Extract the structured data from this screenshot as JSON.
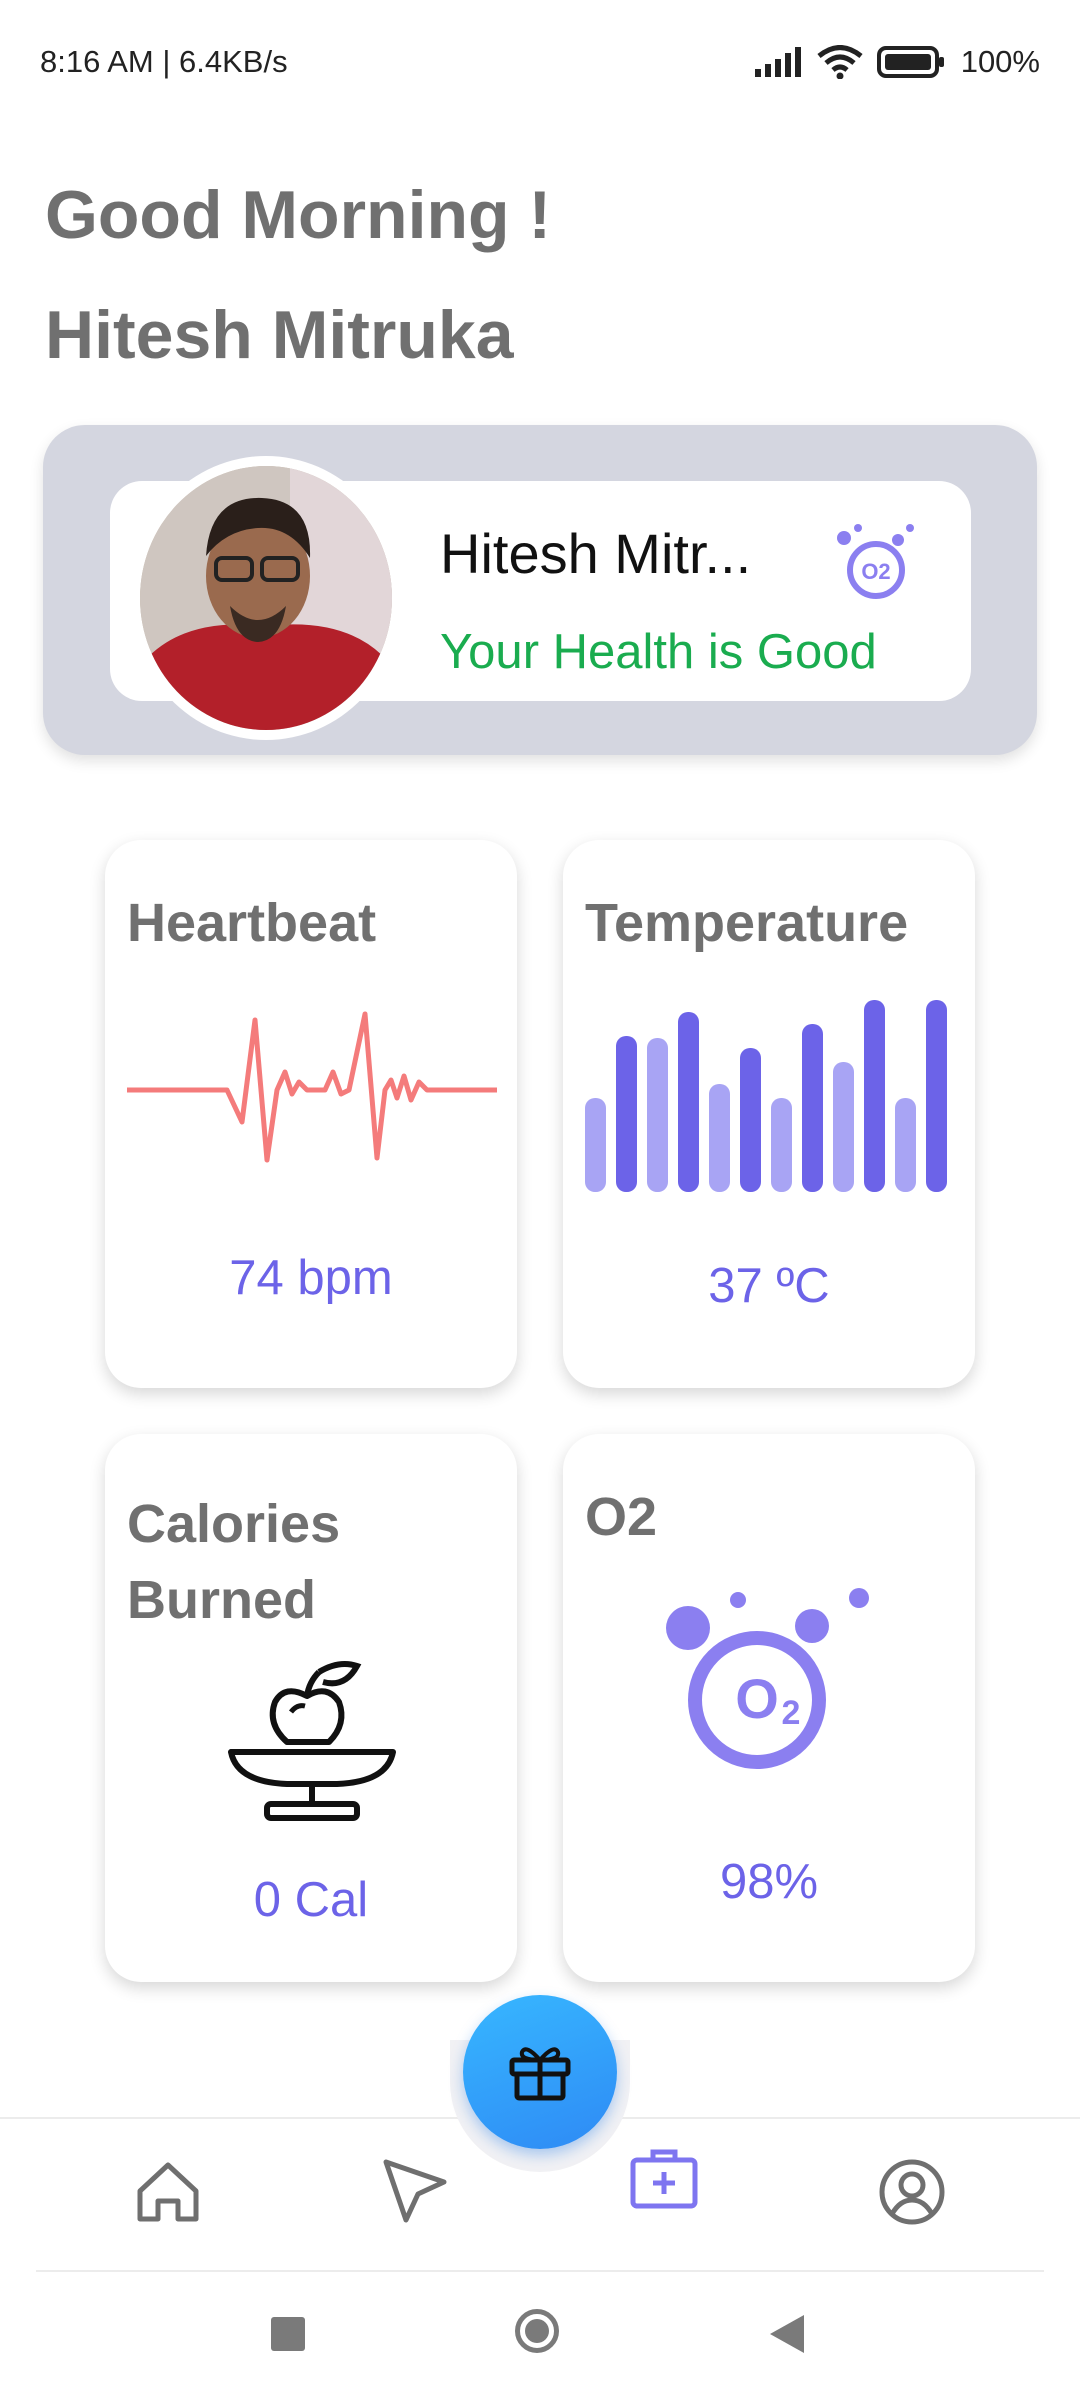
{
  "status_bar": {
    "time_speed": "8:16 AM | 6.4KB/s",
    "battery": "100%",
    "icons": [
      "signal-icon",
      "wifi-icon",
      "battery-icon"
    ]
  },
  "greeting": {
    "line1": "Good Morning !",
    "line2": "Hitesh Mitruka"
  },
  "profile": {
    "name": "Hitesh Mitr...",
    "status": "Your Health is Good",
    "status_color": "#1aac4f",
    "icon": "o2-icon"
  },
  "cards": {
    "heartbeat": {
      "title": "Heartbeat",
      "value": "74 bpm",
      "icon": "heartbeat-line-icon",
      "color": "#f47b7b"
    },
    "temperature": {
      "title": "Temperature",
      "value": "37 ºC",
      "icon": "bar-chart-icon"
    },
    "calories": {
      "title": "Calories Burned",
      "value": "0 Cal",
      "icon": "apple-scale-icon"
    },
    "o2": {
      "title": "O2",
      "value": "98%",
      "icon": "o2-icon"
    }
  },
  "colors": {
    "accent": "#6c63e8",
    "card_bg": "#ffffff",
    "profile_bg": "#d4d6e0",
    "fab": "#2e8af5"
  },
  "nav": {
    "items": [
      "home-icon",
      "send-icon",
      "medical-kit-icon",
      "profile-icon"
    ],
    "active": "medical-kit-icon",
    "fab_icon": "gift-icon"
  },
  "system_nav": [
    "recents-button",
    "home-button",
    "back-button"
  ]
}
